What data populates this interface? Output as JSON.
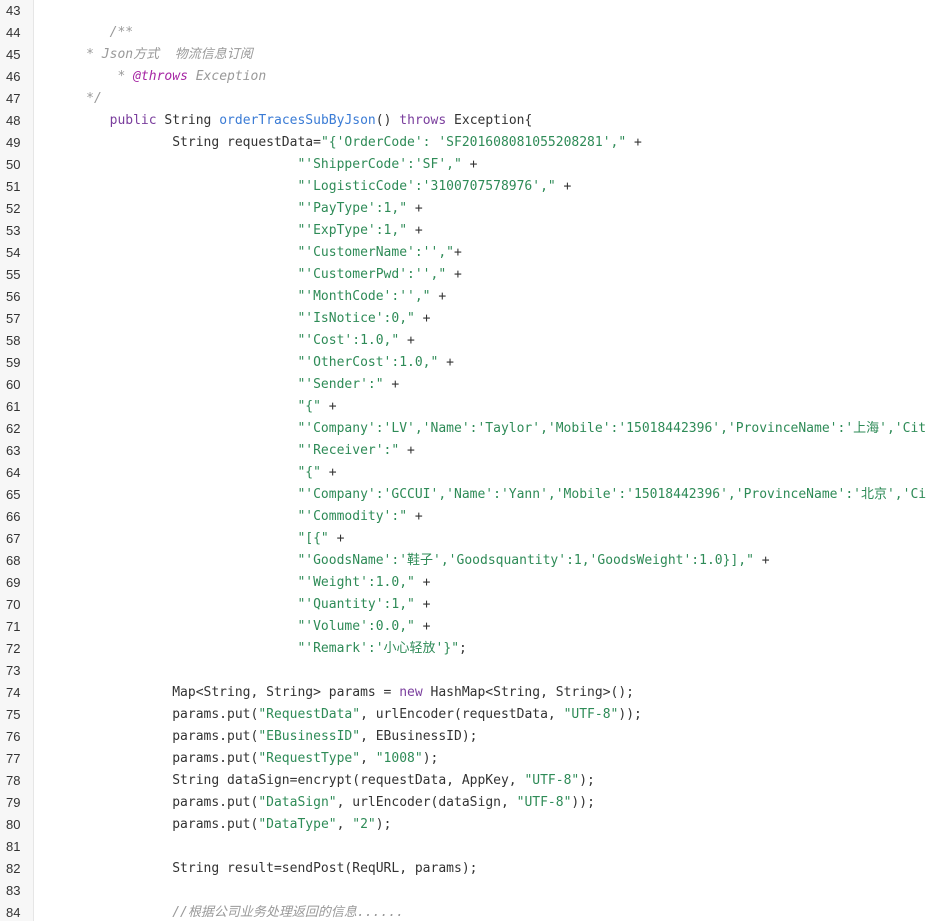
{
  "colors": {
    "gutter_bg": "#f7f7f7",
    "comment": "#999999",
    "keyword": "#7a3e9d",
    "function": "#3a7bd5",
    "string": "#2e8b57",
    "plain": "#333333"
  },
  "lines": [
    {
      "num": "43",
      "tokens": []
    },
    {
      "num": "44",
      "tokens": [
        {
          "t": "        ",
          "c": "plain"
        },
        {
          "t": "/**",
          "c": "comment"
        }
      ]
    },
    {
      "num": "45",
      "tokens": [
        {
          "t": "     ",
          "c": "plain"
        },
        {
          "t": "* Json方式  物流信息订阅",
          "c": "comment"
        }
      ]
    },
    {
      "num": "46",
      "tokens": [
        {
          "t": "         ",
          "c": "plain"
        },
        {
          "t": "* ",
          "c": "comment"
        },
        {
          "t": "@throws",
          "c": "annot"
        },
        {
          "t": " Exception",
          "c": "comment"
        }
      ]
    },
    {
      "num": "47",
      "tokens": [
        {
          "t": "     ",
          "c": "plain"
        },
        {
          "t": "*/",
          "c": "comment"
        }
      ]
    },
    {
      "num": "48",
      "tokens": [
        {
          "t": "        ",
          "c": "plain"
        },
        {
          "t": "public",
          "c": "kw"
        },
        {
          "t": " String ",
          "c": "plain"
        },
        {
          "t": "orderTracesSubByJson",
          "c": "fn"
        },
        {
          "t": "() ",
          "c": "plain"
        },
        {
          "t": "throws",
          "c": "kw"
        },
        {
          "t": " Exception{",
          "c": "plain"
        }
      ]
    },
    {
      "num": "49",
      "tokens": [
        {
          "t": "                String requestData=",
          "c": "plain"
        },
        {
          "t": "\"{'OrderCode': 'SF201608081055208281',\"",
          "c": "str"
        },
        {
          "t": " +",
          "c": "plain"
        }
      ]
    },
    {
      "num": "50",
      "tokens": [
        {
          "t": "                                ",
          "c": "plain"
        },
        {
          "t": "\"'ShipperCode':'SF',\"",
          "c": "str"
        },
        {
          "t": " +",
          "c": "plain"
        }
      ]
    },
    {
      "num": "51",
      "tokens": [
        {
          "t": "                                ",
          "c": "plain"
        },
        {
          "t": "\"'LogisticCode':'3100707578976',\"",
          "c": "str"
        },
        {
          "t": " +",
          "c": "plain"
        }
      ]
    },
    {
      "num": "52",
      "tokens": [
        {
          "t": "                                ",
          "c": "plain"
        },
        {
          "t": "\"'PayType':1,\"",
          "c": "str"
        },
        {
          "t": " +",
          "c": "plain"
        }
      ]
    },
    {
      "num": "53",
      "tokens": [
        {
          "t": "                                ",
          "c": "plain"
        },
        {
          "t": "\"'ExpType':1,\"",
          "c": "str"
        },
        {
          "t": " +",
          "c": "plain"
        }
      ]
    },
    {
      "num": "54",
      "tokens": [
        {
          "t": "                                ",
          "c": "plain"
        },
        {
          "t": "\"'CustomerName':'',\"",
          "c": "str"
        },
        {
          "t": "+",
          "c": "plain"
        }
      ]
    },
    {
      "num": "55",
      "tokens": [
        {
          "t": "                                ",
          "c": "plain"
        },
        {
          "t": "\"'CustomerPwd':'',\"",
          "c": "str"
        },
        {
          "t": " +",
          "c": "plain"
        }
      ]
    },
    {
      "num": "56",
      "tokens": [
        {
          "t": "                                ",
          "c": "plain"
        },
        {
          "t": "\"'MonthCode':'',\"",
          "c": "str"
        },
        {
          "t": " +",
          "c": "plain"
        }
      ]
    },
    {
      "num": "57",
      "tokens": [
        {
          "t": "                                ",
          "c": "plain"
        },
        {
          "t": "\"'IsNotice':0,\"",
          "c": "str"
        },
        {
          "t": " +",
          "c": "plain"
        }
      ]
    },
    {
      "num": "58",
      "tokens": [
        {
          "t": "                                ",
          "c": "plain"
        },
        {
          "t": "\"'Cost':1.0,\"",
          "c": "str"
        },
        {
          "t": " +",
          "c": "plain"
        }
      ]
    },
    {
      "num": "59",
      "tokens": [
        {
          "t": "                                ",
          "c": "plain"
        },
        {
          "t": "\"'OtherCost':1.0,\"",
          "c": "str"
        },
        {
          "t": " +",
          "c": "plain"
        }
      ]
    },
    {
      "num": "60",
      "tokens": [
        {
          "t": "                                ",
          "c": "plain"
        },
        {
          "t": "\"'Sender':\"",
          "c": "str"
        },
        {
          "t": " +",
          "c": "plain"
        }
      ]
    },
    {
      "num": "61",
      "tokens": [
        {
          "t": "                                ",
          "c": "plain"
        },
        {
          "t": "\"{\"",
          "c": "str"
        },
        {
          "t": " +",
          "c": "plain"
        }
      ]
    },
    {
      "num": "62",
      "tokens": [
        {
          "t": "                                ",
          "c": "plain"
        },
        {
          "t": "\"'Company':'LV','Name':'Taylor','Mobile':'15018442396','ProvinceName':'上海','Cit",
          "c": "str"
        }
      ]
    },
    {
      "num": "63",
      "tokens": [
        {
          "t": "                                ",
          "c": "plain"
        },
        {
          "t": "\"'Receiver':\"",
          "c": "str"
        },
        {
          "t": " +",
          "c": "plain"
        }
      ]
    },
    {
      "num": "64",
      "tokens": [
        {
          "t": "                                ",
          "c": "plain"
        },
        {
          "t": "\"{\"",
          "c": "str"
        },
        {
          "t": " +",
          "c": "plain"
        }
      ]
    },
    {
      "num": "65",
      "tokens": [
        {
          "t": "                                ",
          "c": "plain"
        },
        {
          "t": "\"'Company':'GCCUI','Name':'Yann','Mobile':'15018442396','ProvinceName':'北京','Ci",
          "c": "str"
        }
      ]
    },
    {
      "num": "66",
      "tokens": [
        {
          "t": "                                ",
          "c": "plain"
        },
        {
          "t": "\"'Commodity':\"",
          "c": "str"
        },
        {
          "t": " +",
          "c": "plain"
        }
      ]
    },
    {
      "num": "67",
      "tokens": [
        {
          "t": "                                ",
          "c": "plain"
        },
        {
          "t": "\"[{\"",
          "c": "str"
        },
        {
          "t": " +",
          "c": "plain"
        }
      ]
    },
    {
      "num": "68",
      "tokens": [
        {
          "t": "                                ",
          "c": "plain"
        },
        {
          "t": "\"'GoodsName':'鞋子','Goodsquantity':1,'GoodsWeight':1.0}],\"",
          "c": "str"
        },
        {
          "t": " +",
          "c": "plain"
        }
      ]
    },
    {
      "num": "69",
      "tokens": [
        {
          "t": "                                ",
          "c": "plain"
        },
        {
          "t": "\"'Weight':1.0,\"",
          "c": "str"
        },
        {
          "t": " +",
          "c": "plain"
        }
      ]
    },
    {
      "num": "70",
      "tokens": [
        {
          "t": "                                ",
          "c": "plain"
        },
        {
          "t": "\"'Quantity':1,\"",
          "c": "str"
        },
        {
          "t": " +",
          "c": "plain"
        }
      ]
    },
    {
      "num": "71",
      "tokens": [
        {
          "t": "                                ",
          "c": "plain"
        },
        {
          "t": "\"'Volume':0.0,\"",
          "c": "str"
        },
        {
          "t": " +",
          "c": "plain"
        }
      ]
    },
    {
      "num": "72",
      "tokens": [
        {
          "t": "                                ",
          "c": "plain"
        },
        {
          "t": "\"'Remark':'小心轻放'}\"",
          "c": "str"
        },
        {
          "t": ";",
          "c": "plain"
        }
      ]
    },
    {
      "num": "73",
      "tokens": []
    },
    {
      "num": "74",
      "tokens": [
        {
          "t": "                Map<String, String> params = ",
          "c": "plain"
        },
        {
          "t": "new",
          "c": "kw"
        },
        {
          "t": " HashMap<String, String>();",
          "c": "plain"
        }
      ]
    },
    {
      "num": "75",
      "tokens": [
        {
          "t": "                params.put(",
          "c": "plain"
        },
        {
          "t": "\"RequestData\"",
          "c": "str"
        },
        {
          "t": ", urlEncoder(requestData, ",
          "c": "plain"
        },
        {
          "t": "\"UTF-8\"",
          "c": "str"
        },
        {
          "t": "));",
          "c": "plain"
        }
      ]
    },
    {
      "num": "76",
      "tokens": [
        {
          "t": "                params.put(",
          "c": "plain"
        },
        {
          "t": "\"EBusinessID\"",
          "c": "str"
        },
        {
          "t": ", EBusinessID);",
          "c": "plain"
        }
      ]
    },
    {
      "num": "77",
      "tokens": [
        {
          "t": "                params.put(",
          "c": "plain"
        },
        {
          "t": "\"RequestType\"",
          "c": "str"
        },
        {
          "t": ", ",
          "c": "plain"
        },
        {
          "t": "\"1008\"",
          "c": "str"
        },
        {
          "t": ");",
          "c": "plain"
        }
      ]
    },
    {
      "num": "78",
      "tokens": [
        {
          "t": "                String dataSign=encrypt(requestData, AppKey, ",
          "c": "plain"
        },
        {
          "t": "\"UTF-8\"",
          "c": "str"
        },
        {
          "t": ");",
          "c": "plain"
        }
      ]
    },
    {
      "num": "79",
      "tokens": [
        {
          "t": "                params.put(",
          "c": "plain"
        },
        {
          "t": "\"DataSign\"",
          "c": "str"
        },
        {
          "t": ", urlEncoder(dataSign, ",
          "c": "plain"
        },
        {
          "t": "\"UTF-8\"",
          "c": "str"
        },
        {
          "t": "));",
          "c": "plain"
        }
      ]
    },
    {
      "num": "80",
      "tokens": [
        {
          "t": "                params.put(",
          "c": "plain"
        },
        {
          "t": "\"DataType\"",
          "c": "str"
        },
        {
          "t": ", ",
          "c": "plain"
        },
        {
          "t": "\"2\"",
          "c": "str"
        },
        {
          "t": ");",
          "c": "plain"
        }
      ]
    },
    {
      "num": "81",
      "tokens": []
    },
    {
      "num": "82",
      "tokens": [
        {
          "t": "                String result=sendPost(ReqURL, params);",
          "c": "plain"
        }
      ]
    },
    {
      "num": "83",
      "tokens": []
    },
    {
      "num": "84",
      "tokens": [
        {
          "t": "                ",
          "c": "plain"
        },
        {
          "t": "//根据公司业务处理返回的信息......",
          "c": "comment"
        }
      ]
    }
  ]
}
